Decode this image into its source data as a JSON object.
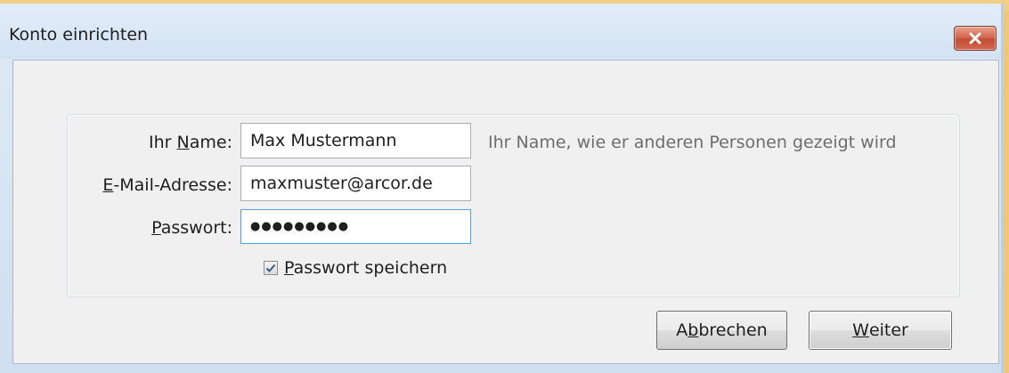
{
  "window": {
    "title": "Konto einrichten",
    "close_icon": "close-x-icon"
  },
  "form": {
    "name": {
      "label_pre": "Ihr ",
      "label_accel": "N",
      "label_post": "ame:",
      "value": "Max Mustermann",
      "hint": "Ihr Name, wie er anderen Personen gezeigt wird"
    },
    "email": {
      "label_pre": "",
      "label_accel": "E",
      "label_post": "-Mail-Adresse:",
      "value": "maxmuster@arcor.de"
    },
    "password": {
      "label_pre": "",
      "label_accel": "P",
      "label_post": "asswort:",
      "value_masked": "●●●●●●●●●"
    },
    "remember": {
      "checked": true,
      "label_pre": "",
      "label_accel": "P",
      "label_post": "asswort speichern"
    }
  },
  "buttons": {
    "cancel": {
      "pre": "A",
      "accel": "b",
      "post": "brechen"
    },
    "next": {
      "pre": "",
      "accel": "W",
      "post": "eiter"
    }
  }
}
